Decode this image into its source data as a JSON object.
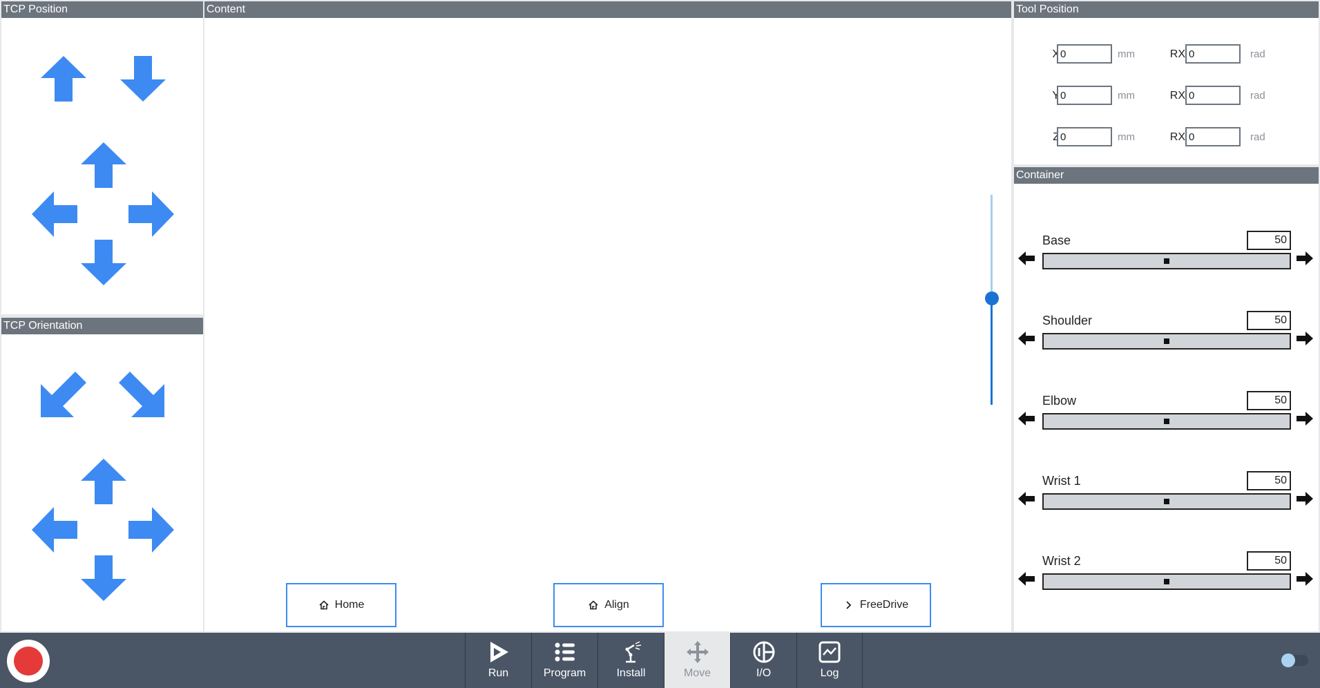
{
  "panels": {
    "tcp_position": "TCP Position",
    "tcp_orientation": "TCP Orientation",
    "content": "Content",
    "tool_position": "Tool Position",
    "container": "Container"
  },
  "content_buttons": {
    "home": "Home",
    "align": "Align",
    "freedrive": "FreeDrive"
  },
  "tool_fields": [
    {
      "label": "X",
      "value": "0",
      "unit": "mm",
      "rlabel": "RX",
      "rvalue": "0",
      "runit": "rad"
    },
    {
      "label": "Y",
      "value": "0",
      "unit": "mm",
      "rlabel": "RX",
      "rvalue": "0",
      "runit": "rad"
    },
    {
      "label": "Z",
      "value": "0",
      "unit": "mm",
      "rlabel": "RX",
      "rvalue": "0",
      "runit": "rad"
    }
  ],
  "joints": [
    {
      "label": "Base",
      "value": "50",
      "level": 0.5
    },
    {
      "label": "Shoulder",
      "value": "50",
      "level": 0.5
    },
    {
      "label": "Elbow",
      "value": "50",
      "level": 0.5
    },
    {
      "label": "Wrist 1",
      "value": "50",
      "level": 0.5
    },
    {
      "label": "Wrist 2",
      "value": "50",
      "level": 0.5
    }
  ],
  "speed_slider_level": 0.5,
  "nav": {
    "run": "Run",
    "program": "Program",
    "install": "Install",
    "move": "Move",
    "io": "I/O",
    "log": "Log"
  },
  "colors": {
    "accent_blue": "#3d8af2",
    "header_gray": "#6c747e",
    "bottom_bar": "#4a5565",
    "power_red": "#e43a3a"
  }
}
